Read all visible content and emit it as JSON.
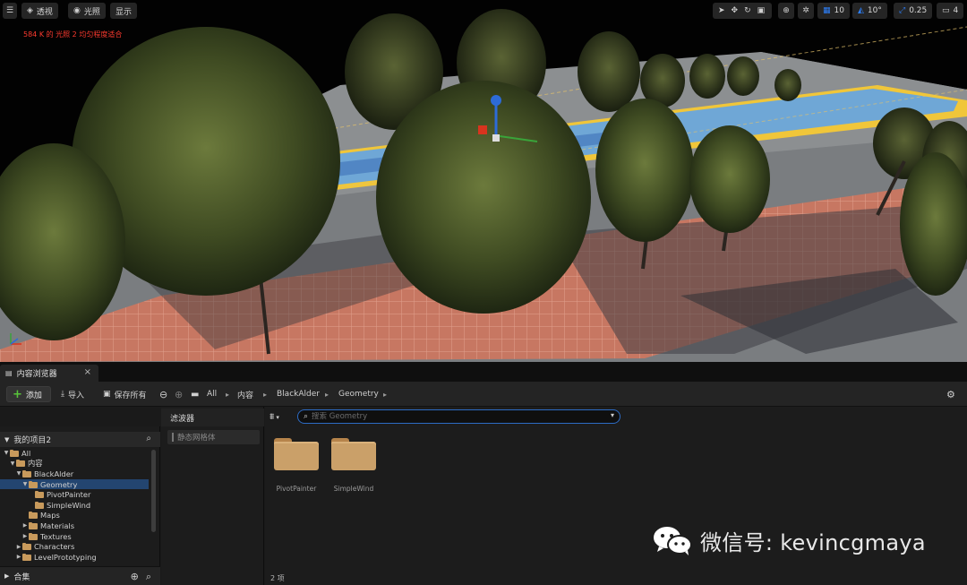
{
  "viewport": {
    "toolbar_left": [
      {
        "icon": "hamburger-icon",
        "label": ""
      },
      {
        "icon": "perspective-cube-icon",
        "label": "透视"
      },
      {
        "icon": "lighting-bulb-icon",
        "label": "光照"
      },
      {
        "icon": "",
        "label": "显示"
      }
    ],
    "toolbar_right": {
      "grid_snap_value": "10",
      "rotation_snap_value": "10°",
      "scale_snap_value": "0.25",
      "camera_speed_value": "4"
    },
    "warning_text": "584 K 的 光照 2 均匀程度适合",
    "accent_color": "#2d7ff9",
    "warning_color": "#ff3a2f"
  },
  "content_browser": {
    "tab_title": "内容浏览器",
    "toolbar": {
      "add_label": "添加",
      "import_label": "导入",
      "save_all_label": "保存所有"
    },
    "breadcrumbs": [
      "All",
      "内容",
      "BlackAlder",
      "Geometry"
    ],
    "tree": {
      "header": "我的项目2",
      "items": [
        {
          "label": "All",
          "depth": 0,
          "expanded": true,
          "selected": false
        },
        {
          "label": "内容",
          "depth": 1,
          "expanded": true,
          "selected": false
        },
        {
          "label": "BlackAlder",
          "depth": 2,
          "expanded": true,
          "selected": false
        },
        {
          "label": "Geometry",
          "depth": 3,
          "expanded": true,
          "selected": true
        },
        {
          "label": "PivotPainter",
          "depth": 4,
          "expanded": false,
          "selected": false,
          "leaf": true
        },
        {
          "label": "SimpleWind",
          "depth": 4,
          "expanded": false,
          "selected": false,
          "leaf": true
        },
        {
          "label": "Maps",
          "depth": 3,
          "expanded": false,
          "selected": false,
          "leaf": true
        },
        {
          "label": "Materials",
          "depth": 3,
          "expanded": false,
          "selected": false
        },
        {
          "label": "Textures",
          "depth": 3,
          "expanded": false,
          "selected": false
        },
        {
          "label": "Characters",
          "depth": 2,
          "expanded": false,
          "selected": false
        },
        {
          "label": "LevelPrototyping",
          "depth": 2,
          "expanded": false,
          "selected": false
        }
      ],
      "footer": "合集"
    },
    "filters": {
      "title": "滤波器",
      "items": [
        "静态网格体"
      ]
    },
    "search": {
      "placeholder": "搜索 Geometry"
    },
    "assets": [
      {
        "label": "PivotPainter",
        "icon": "folder-icon"
      },
      {
        "label": "SimpleWind",
        "icon": "folder-icon"
      }
    ],
    "item_count": "2 项",
    "selection_color": "#234570",
    "folder_color": "#caa069"
  },
  "watermark": {
    "text": "微信号: kevincgmaya"
  }
}
